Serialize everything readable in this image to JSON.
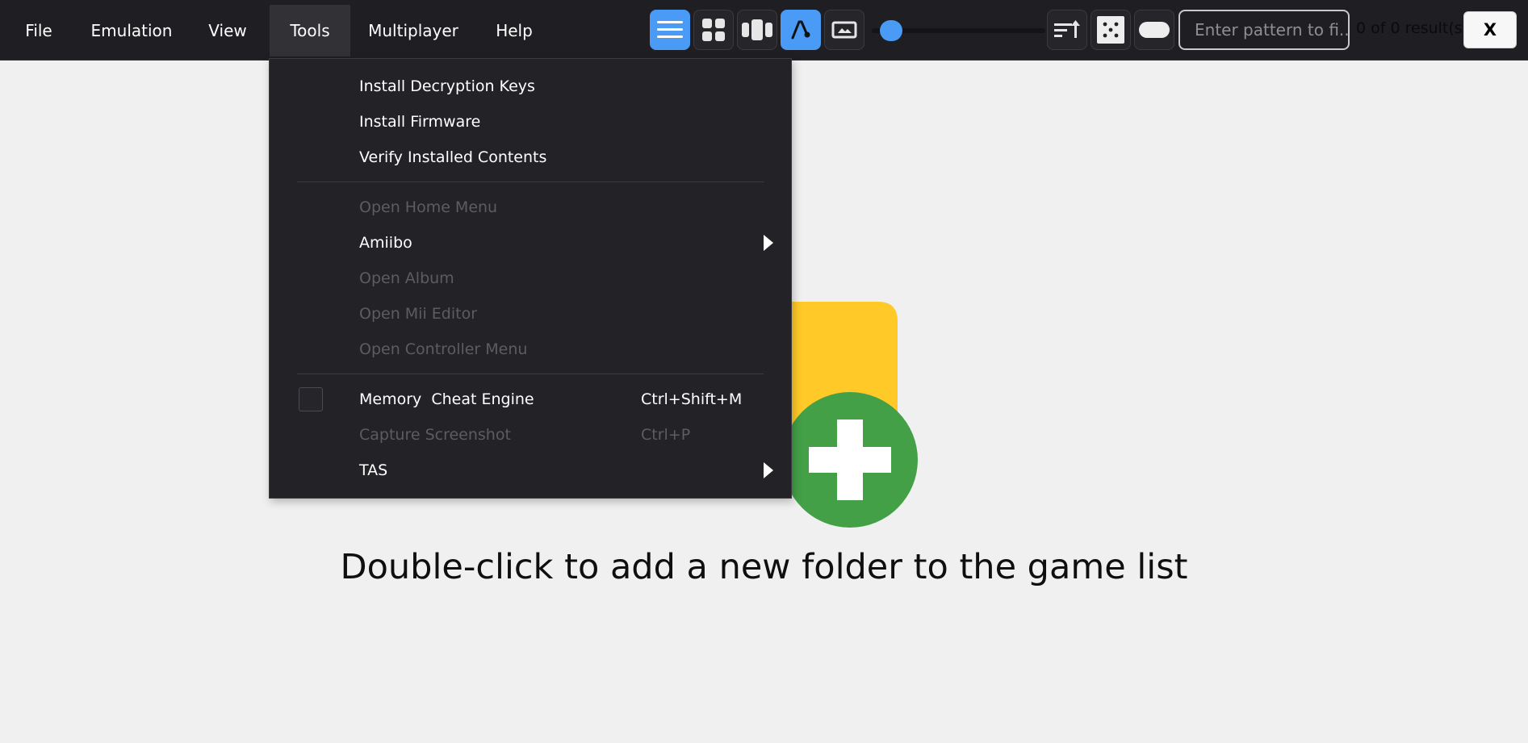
{
  "menubar": {
    "items": [
      {
        "label": "File"
      },
      {
        "label": "Emulation"
      },
      {
        "label": "View"
      },
      {
        "label": "Tools",
        "active": true
      },
      {
        "label": "Multiplayer"
      },
      {
        "label": "Help"
      }
    ]
  },
  "toolbar": {
    "buttons": [
      {
        "name": "list-view-icon",
        "on": true
      },
      {
        "name": "grid-view-icon",
        "on": false
      },
      {
        "name": "carousel-view-icon",
        "on": false
      },
      {
        "name": "font-icon",
        "on": true
      },
      {
        "name": "image-icon",
        "on": false
      },
      {
        "name": "sort-icon",
        "on": false
      },
      {
        "name": "dice-icon",
        "on": false
      },
      {
        "name": "controller-icon",
        "on": false
      }
    ],
    "search_placeholder": "Enter pattern to fi...",
    "results_text": "0 of 0 result(s)",
    "close_label": "X",
    "accent_color": "#4a9bf5"
  },
  "tools_menu": {
    "items": [
      {
        "label": "Install Decryption Keys",
        "enabled": true
      },
      {
        "label": "Install Firmware",
        "enabled": true
      },
      {
        "label": "Verify Installed Contents",
        "enabled": true
      },
      {
        "separator": true
      },
      {
        "label": "Open Home Menu",
        "enabled": false
      },
      {
        "label": "Amiibo",
        "enabled": true,
        "submenu": true
      },
      {
        "label": "Open Album",
        "enabled": false
      },
      {
        "label": "Open Mii Editor",
        "enabled": false
      },
      {
        "label": "Open Controller Menu",
        "enabled": false
      },
      {
        "separator": true
      },
      {
        "label": "Memory  Cheat Engine",
        "enabled": true,
        "checkable": true,
        "checked": false,
        "shortcut": "Ctrl+Shift+M"
      },
      {
        "label": "Capture Screenshot",
        "enabled": false,
        "shortcut": "Ctrl+P"
      },
      {
        "label": "TAS",
        "enabled": true,
        "submenu": true
      }
    ]
  },
  "empty_state": {
    "text": "Double-click to add a new folder to the game list",
    "icon": "folder-add-icon",
    "folder_color": "#ffc928",
    "plus_color": "#43a047"
  }
}
